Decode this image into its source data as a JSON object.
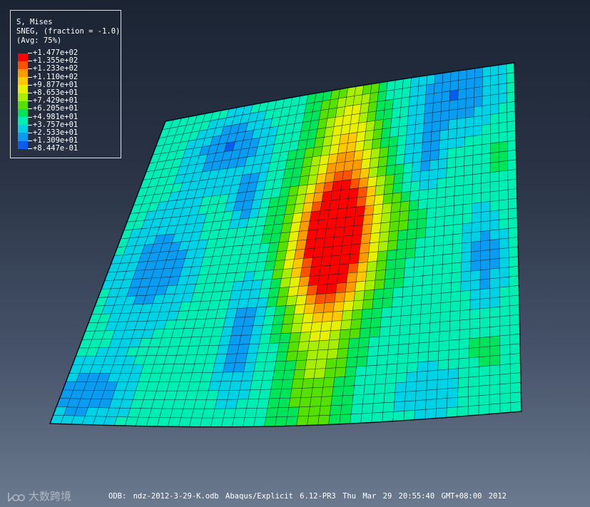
{
  "legend": {
    "title_line1": "S, Mises",
    "title_line2": "SNEG, (fraction = -1.0)",
    "title_line3": "(Avg: 75%)",
    "values": [
      "+1.477e+02",
      "+1.355e+02",
      "+1.233e+02",
      "+1.110e+02",
      "+9.877e+01",
      "+8.653e+01",
      "+7.429e+01",
      "+6.205e+01",
      "+4.981e+01",
      "+3.757e+01",
      "+2.533e+01",
      "+1.309e+01",
      "+8.447e-01"
    ],
    "colors": [
      "#ff0000",
      "#ff5200",
      "#ff9900",
      "#ffc800",
      "#e6f000",
      "#a8ee00",
      "#55e000",
      "#00e45a",
      "#00eeb4",
      "#00d2e6",
      "#0a9cf0",
      "#0a5cf0",
      "#0000ff"
    ]
  },
  "status_bar": {
    "text": "ODB: ndz-2012-3-29-K.odb    Abaqus/Explicit 6.12-PR3    Thu Mar 29 20:55:40 GMT+08:00 2012"
  },
  "watermark": {
    "text": "大数跨境"
  },
  "mesh": {
    "nx": 44,
    "ny": 36,
    "line_color": "#0b1a2c"
  }
}
